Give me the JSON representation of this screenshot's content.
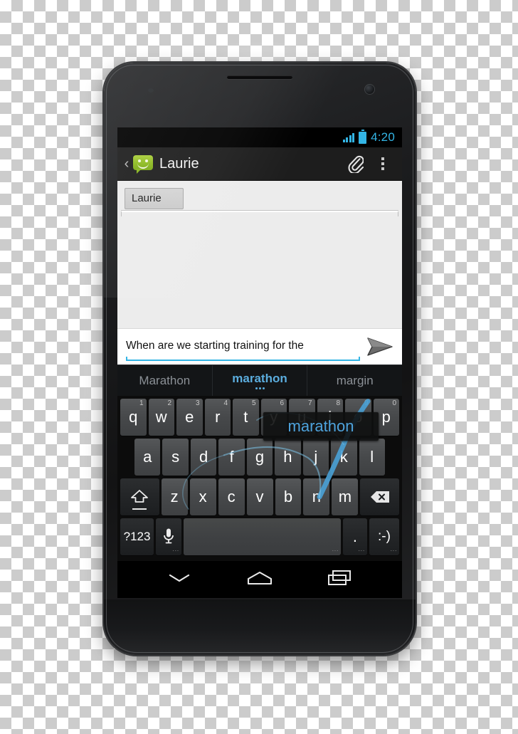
{
  "status_bar": {
    "time": "4:20",
    "signal_icon": "signal-bars-icon",
    "battery_icon": "battery-full-icon",
    "accent_color": "#33b5e5"
  },
  "action_bar": {
    "up_caret": "‹",
    "app_icon": "messaging-bubble-icon",
    "title": "Laurie",
    "attach_icon": "paperclip-icon",
    "overflow_icon": "overflow-menu-icon"
  },
  "compose": {
    "recipient_chip": "Laurie",
    "message_text": "When are we starting training for the",
    "send_icon": "send-arrow-icon",
    "underline_color": "#33b5e5"
  },
  "suggestions": {
    "items": [
      {
        "label": "Marathon",
        "active": false
      },
      {
        "label": "marathon",
        "active": true
      },
      {
        "label": "margin",
        "active": false
      }
    ],
    "active_color": "#5badde",
    "inactive_color": "#8b9096"
  },
  "keyboard": {
    "gesture_preview": "marathon",
    "gesture_trail_color": "#4a9fd4",
    "row1": [
      {
        "key": "q",
        "num": "1"
      },
      {
        "key": "w",
        "num": "2"
      },
      {
        "key": "e",
        "num": "3"
      },
      {
        "key": "r",
        "num": "4"
      },
      {
        "key": "t",
        "num": "5"
      },
      {
        "key": "y",
        "num": "6"
      },
      {
        "key": "u",
        "num": "7"
      },
      {
        "key": "i",
        "num": "8"
      },
      {
        "key": "o",
        "num": "9"
      },
      {
        "key": "p",
        "num": "0"
      }
    ],
    "row2": [
      "a",
      "s",
      "d",
      "f",
      "g",
      "h",
      "j",
      "k",
      "l"
    ],
    "row3_letters": [
      "z",
      "x",
      "c",
      "v",
      "b",
      "n",
      "m"
    ],
    "shift_key": "shift-key",
    "delete_key": "backspace-key",
    "row4": {
      "symbols": "?123",
      "mic": "microphone-icon",
      "space": "",
      "period": ".",
      "emoji": ":-)"
    }
  },
  "nav_bar": {
    "back": "hide-keyboard-icon",
    "home": "home-icon",
    "recents": "recent-apps-icon"
  }
}
